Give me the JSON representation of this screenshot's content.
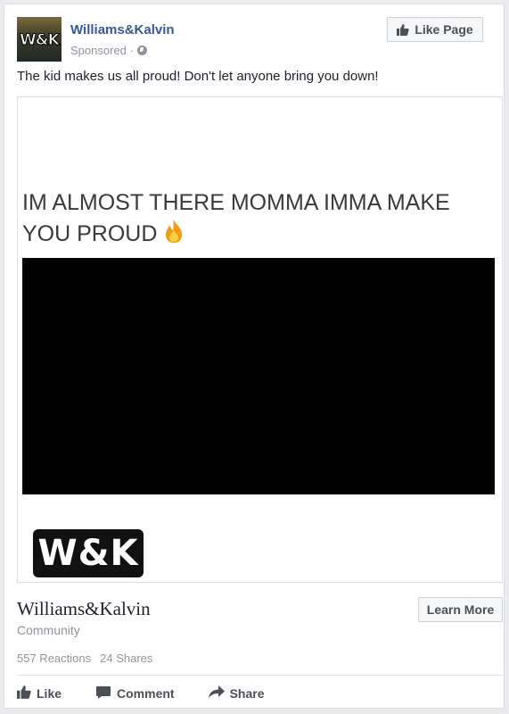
{
  "post": {
    "page_name": "Williams&Kalvin",
    "sponsored_label": "Sponsored ·",
    "like_page_label": "Like Page",
    "text": "The kid makes us all proud! Don't let anyone bring you down!",
    "avatar_text": "W&K"
  },
  "media": {
    "meme_text": "IM ALMOST THERE MOMMA IMMA MAKE YOU PROUD",
    "logo_text": "W&K"
  },
  "link_footer": {
    "name": "Williams&Kalvin",
    "category": "Community",
    "cta_label": "Learn More"
  },
  "stats": {
    "reactions": "557 Reactions",
    "shares": "24 Shares"
  },
  "actions": {
    "like": "Like",
    "comment": "Comment",
    "share": "Share"
  },
  "colors": {
    "link_blue": "#365899",
    "meta_gray": "#90949c",
    "text_dark": "#1d2129",
    "button_text": "#4b4f56"
  }
}
